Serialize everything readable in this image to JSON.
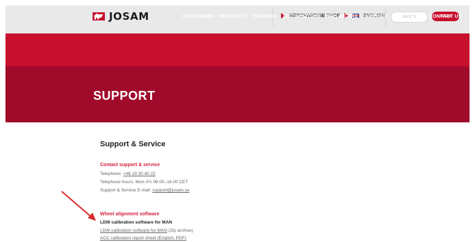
{
  "header": {
    "logo_text": "JOSAM",
    "merchandise_label": "MERCHANDISE SHOP",
    "language_label": "ENGLISH",
    "search_placeholder": "SEARCH",
    "login_label": "LOGIN"
  },
  "nav": {
    "items": [
      "CUSTOMERS",
      "PRODUCTS",
      "TRAINING",
      "DISTRIBUTORS",
      "WHO WE ARE",
      "SUPPORT",
      "BROCHURES",
      "CONTACT US"
    ]
  },
  "hero": {
    "title": "SUPPORT"
  },
  "content": {
    "section_title": "Support & Service",
    "contact_heading": "Contact support & service",
    "telephone_label": "Telephone: ",
    "telephone_value": "+46 19 30 40 22",
    "hours_line": "Telephone hours: Mon–Fri 08.00–16.00 CET",
    "email_label": "Support & Service E-mail: ",
    "email_value": "support@josam.se",
    "wheel_heading": "Wheel alignment software",
    "ldw_title": "LDW calibration software for MAN",
    "ldw_link": "LDW calibration software for MAN",
    "ldw_suffix": " (Zip archive)",
    "acc_link": "ACC calibration report sheet (English, PDF)"
  },
  "colors": {
    "brand_red": "#c8102e",
    "hero_red": "#a00a2b",
    "annotation_arrow": "#d62828"
  }
}
